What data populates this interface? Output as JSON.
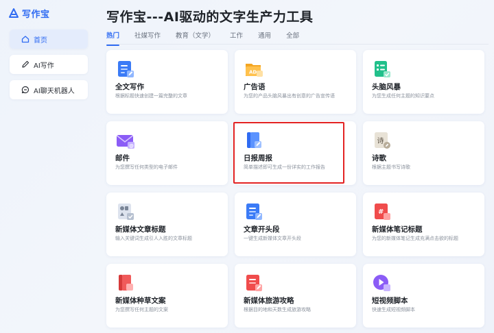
{
  "app": {
    "logo_text": "写作宝",
    "brand_color": "#2f6bf2"
  },
  "sidebar": {
    "items": [
      {
        "label": "首页",
        "icon": "home-icon",
        "active": true
      },
      {
        "label": "AI写作",
        "icon": "pen-icon",
        "active": false
      },
      {
        "label": "AI聊天机器人",
        "icon": "chat-icon",
        "active": false
      }
    ]
  },
  "header": {
    "title": "写作宝---AI驱动的文字生产力工具"
  },
  "tabs": [
    {
      "label": "热门",
      "active": true
    },
    {
      "label": "社媒写作",
      "active": false
    },
    {
      "label": "教育（文学）",
      "active": false
    },
    {
      "label": "工作",
      "active": false
    },
    {
      "label": "通用",
      "active": false
    },
    {
      "label": "全部",
      "active": false
    }
  ],
  "cards": [
    {
      "name": "全文写作",
      "desc": "根据标题快速创建一篇完整的文章",
      "icon": "document-icon"
    },
    {
      "name": "广告语",
      "desc": "为您的产品头脑风暴出有创意的广告宣传语",
      "icon": "ad-folder-icon"
    },
    {
      "name": "头脑风暴",
      "desc": "为您生成任何主题的知识要点",
      "icon": "checklist-icon"
    },
    {
      "name": "邮件",
      "desc": "为您撰写任何类型的电子邮件",
      "icon": "envelope-icon"
    },
    {
      "name": "日报周报",
      "desc": "简单描述即可生成一份详实的工作报告",
      "icon": "report-book-icon"
    },
    {
      "name": "诗歌",
      "desc": "根据主题书写诗歌",
      "icon": "poem-icon"
    },
    {
      "name": "新媒体文章标题",
      "desc": "输入关键词生成引人入胜的文章标题",
      "icon": "shapes-doc-icon"
    },
    {
      "name": "文章开头段",
      "desc": "一键生成新媒体文章开头段",
      "icon": "doc-edit-icon"
    },
    {
      "name": "新媒体笔记标题",
      "desc": "为您的新媒体笔记生成充满点击欲的标题",
      "icon": "red-note-icon"
    },
    {
      "name": "新媒体种草文案",
      "desc": "为您撰写任何主题的文案",
      "icon": "red-book-icon"
    },
    {
      "name": "新媒体旅游攻略",
      "desc": "根据目的地和天数生成旅游攻略",
      "icon": "red-doc-icon"
    },
    {
      "name": "短视频脚本",
      "desc": "快速生成短视频脚本",
      "icon": "video-play-icon"
    }
  ],
  "highlight_card_index": 4,
  "colors": {
    "highlight_border": "#e32222",
    "tab_active": "#2f6bf2"
  }
}
